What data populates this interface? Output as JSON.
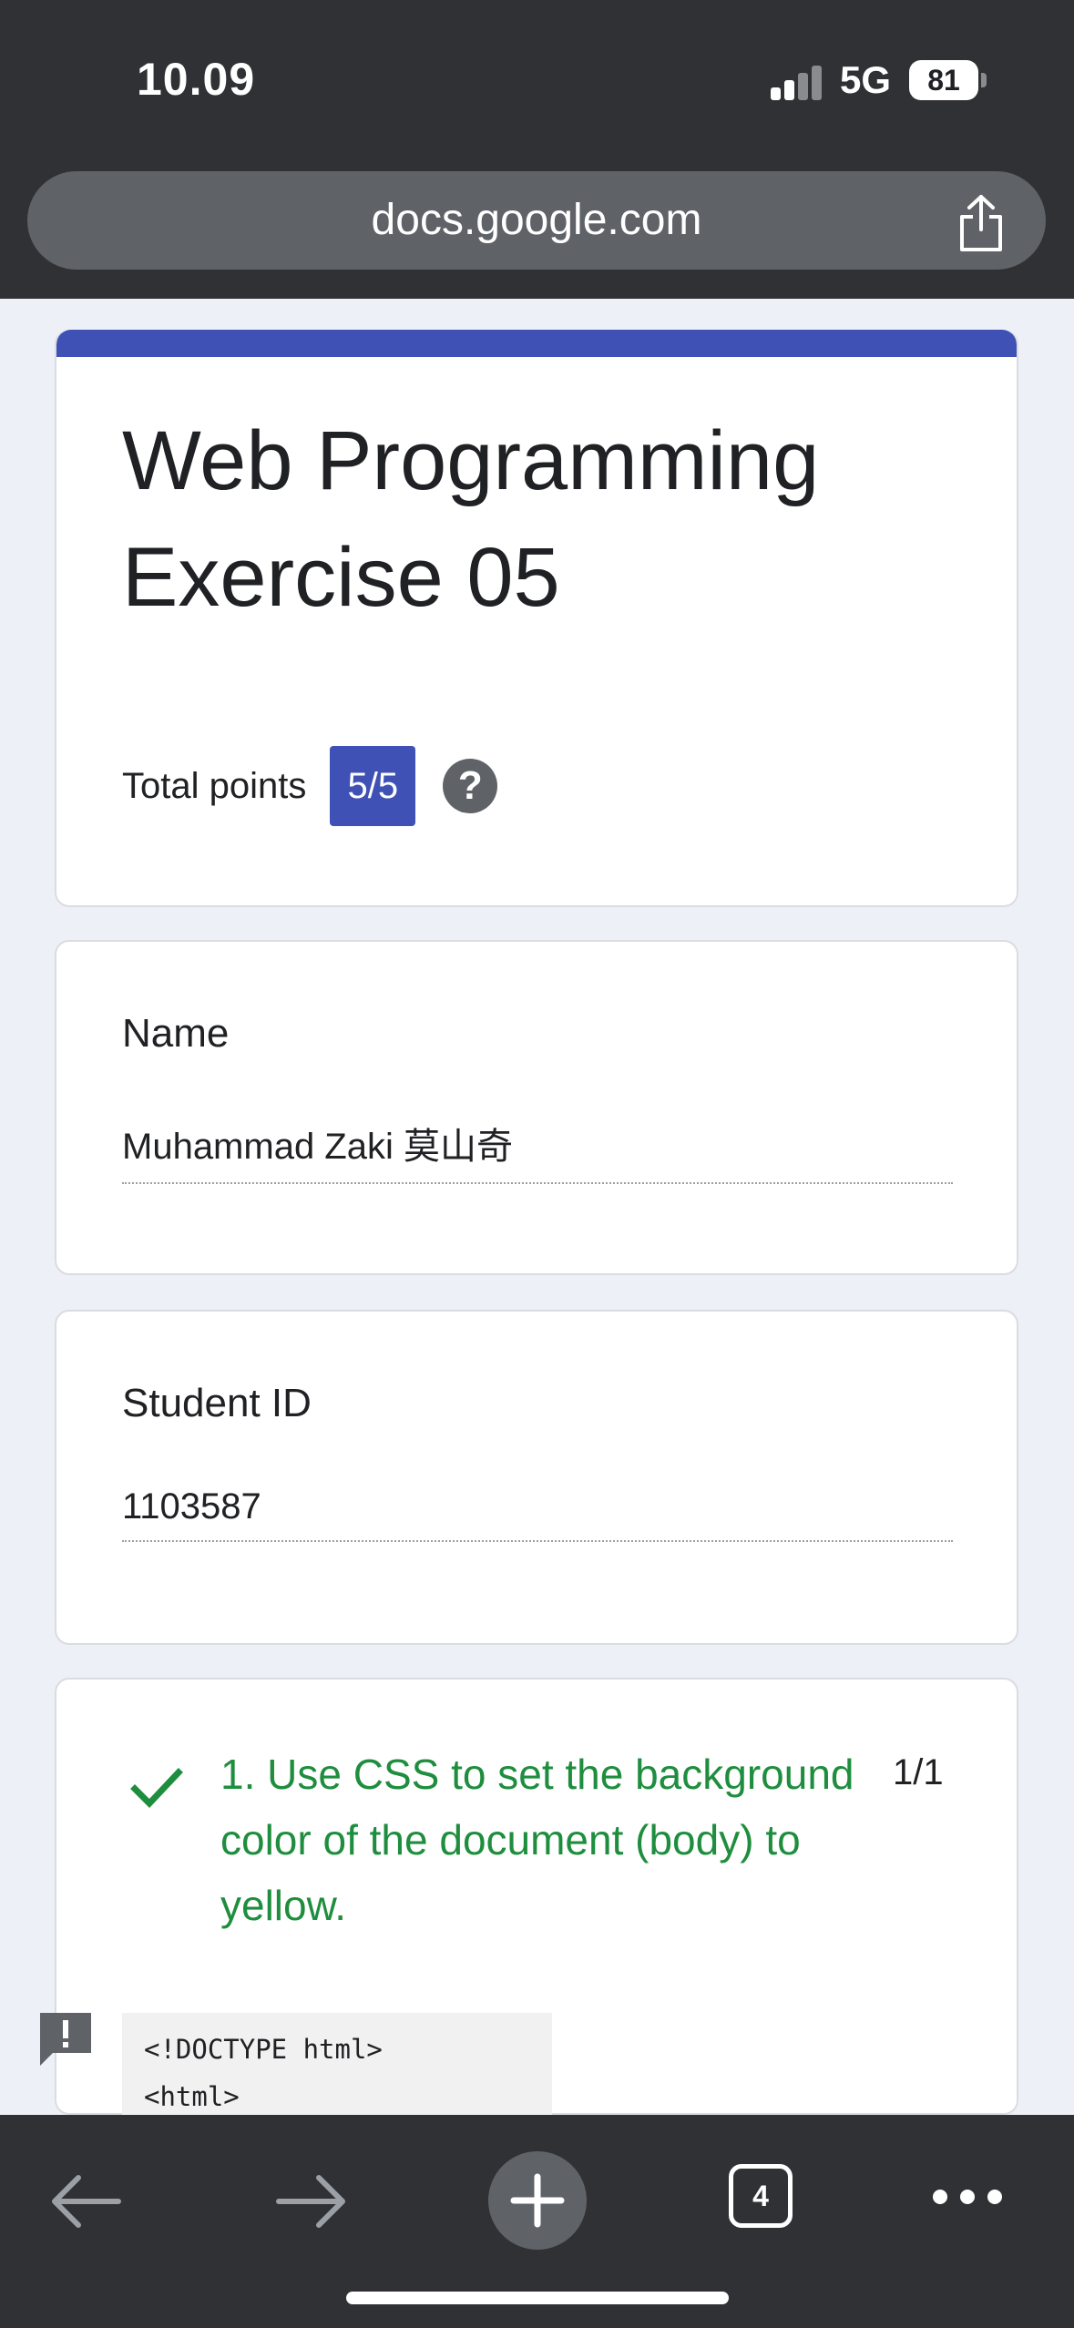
{
  "status_bar": {
    "time": "10.09",
    "network": "5G",
    "battery": "81"
  },
  "browser": {
    "url": "docs.google.com",
    "open_tabs": "4"
  },
  "form": {
    "title": "Web Programming Exercise 05",
    "total_points_label": "Total points",
    "score": "5/5",
    "help_symbol": "?",
    "accent_color": "#3f51b5"
  },
  "questions": [
    {
      "label": "Name",
      "answer": "Muhammad Zaki 莫山奇"
    },
    {
      "label": "Student ID",
      "answer": "1103587"
    }
  ],
  "graded_question": {
    "text": "1. Use CSS to set the background color of the document (body) to yellow.",
    "score": "1/1",
    "status_color": "#1e8e3e",
    "code_lines": [
      "<!DOCTYPE html>",
      "<html>"
    ]
  },
  "icons": {
    "share": "share-icon",
    "help": "help-icon",
    "check": "checkmark-icon",
    "feedback": "feedback-flag-icon",
    "back": "arrow-left-icon",
    "forward": "arrow-right-icon",
    "new_tab": "plus-icon",
    "tabs": "tabs-icon",
    "more": "more-dots-icon"
  }
}
